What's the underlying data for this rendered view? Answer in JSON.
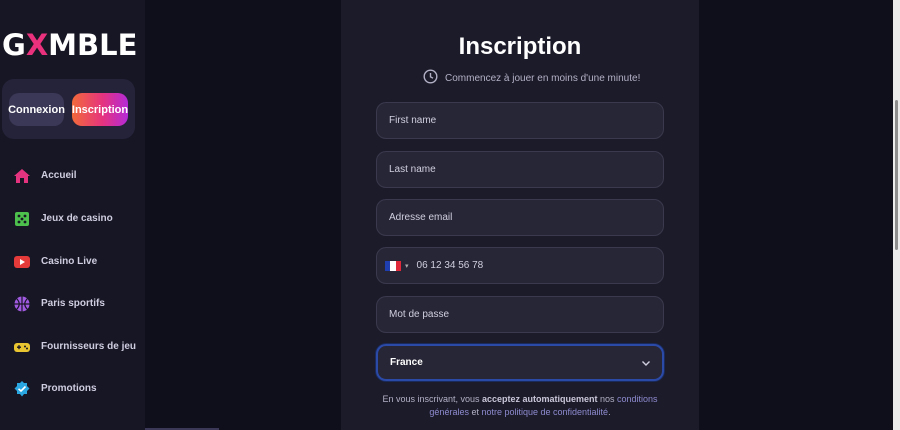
{
  "logo": {
    "pre": "G",
    "x": "X",
    "post": "MBLE"
  },
  "auth": {
    "login_label": "Connexion",
    "signup_label": "Inscription"
  },
  "nav": [
    {
      "label": "Accueil",
      "icon": "home-icon",
      "color": "#e5337f"
    },
    {
      "label": "Jeux de casino",
      "icon": "dice-icon",
      "color": "#4cbf4c"
    },
    {
      "label": "Casino Live",
      "icon": "play-icon",
      "color": "#e53a3a"
    },
    {
      "label": "Paris sportifs",
      "icon": "basketball-icon",
      "color": "#a05ae0"
    },
    {
      "label": "Fournisseurs de jeu",
      "icon": "gamepad-icon",
      "color": "#e8c531"
    },
    {
      "label": "Promotions",
      "icon": "badge-check-icon",
      "color": "#2aa6e0"
    }
  ],
  "form": {
    "title": "Inscription",
    "subtitle": "Commencez à jouer en moins d'une minute!",
    "first_name_placeholder": "First name",
    "last_name_placeholder": "Last name",
    "email_placeholder": "Adresse email",
    "phone_placeholder": "06 12 34 56 78",
    "phone_flag": "France",
    "password_placeholder": "Mot de passe",
    "country_value": "France",
    "terms": {
      "part1": "En vous inscrivant, vous ",
      "bold1": "acceptez automatiquement",
      "part2": " nos ",
      "link1": "conditions générales",
      "part3": " et ",
      "link2": "notre politique de confidentialité",
      "end": "."
    }
  },
  "colors": {
    "accent_start": "#f26a3a",
    "accent_mid": "#e5337f",
    "accent_end": "#b42ad8",
    "panel": "#1c1b29",
    "sidebar": "#171624"
  }
}
